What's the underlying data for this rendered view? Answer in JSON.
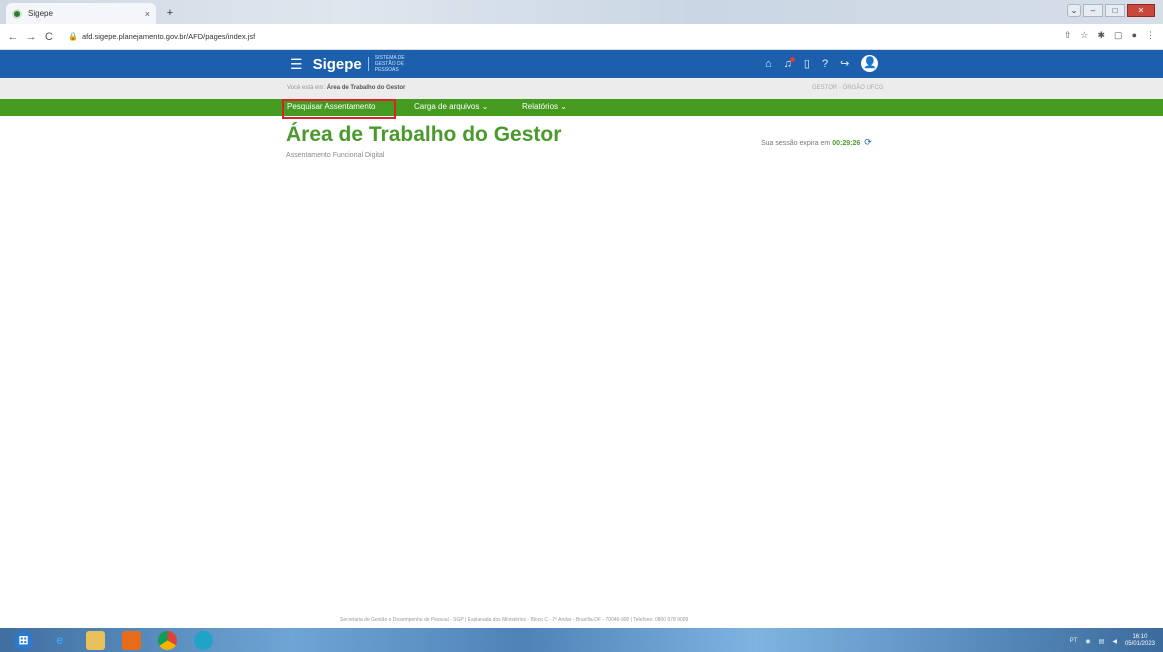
{
  "browser": {
    "tab_title": "Sigepe",
    "tab_close": "×",
    "new_tab": "+",
    "url": "afd.sigepe.planejamento.gov.br/AFD/pages/index.jsf",
    "back": "←",
    "forward": "→",
    "reload": "C",
    "lock": "🔒",
    "window_buttons": {
      "minimize": "–",
      "maximize": "□",
      "close": "✕",
      "dropdown": "⌄"
    },
    "tools": [
      "⇧",
      "☆",
      "✱",
      "▢",
      "●",
      "⋮"
    ]
  },
  "header": {
    "menu_icon": "☰",
    "brand": "Sigepe",
    "brand_sub": "SISTEMA DE GESTÃO DE PESSOAS",
    "icons": {
      "home": "⌂",
      "bell": "♫",
      "doc": "▯",
      "help": "?",
      "logout": "↪",
      "user": "👤"
    }
  },
  "breadcrumb": {
    "prefix": "Você está em:",
    "current": "Área de Trabalho do Gestor",
    "profile": "GESTOR · ÓRGÃO UFCG"
  },
  "nav": {
    "items": [
      "Pesquisar Assentamento",
      "Carga de arquivos",
      "Relatórios"
    ],
    "dropdown_marker": "⌄"
  },
  "main": {
    "title": "Área de Trabalho do Gestor",
    "subtitle": "Assentamento Funcional Digital",
    "session_prefix": "Sua sessão expira em",
    "session_time": "00:29:26",
    "refresh_icon": "⟳"
  },
  "footer": {
    "text": "Secretaria de Gestão e Desempenho de Pessoal - SGP | Esplanada dos Ministérios - Bloco C - 7º Andar - Brasília-DF - 70046-900 | Telefone: 0800 978 9009"
  },
  "taskbar": {
    "tray_lang": "PT",
    "clock_time": "16:10",
    "clock_date": "05/01/2023"
  }
}
